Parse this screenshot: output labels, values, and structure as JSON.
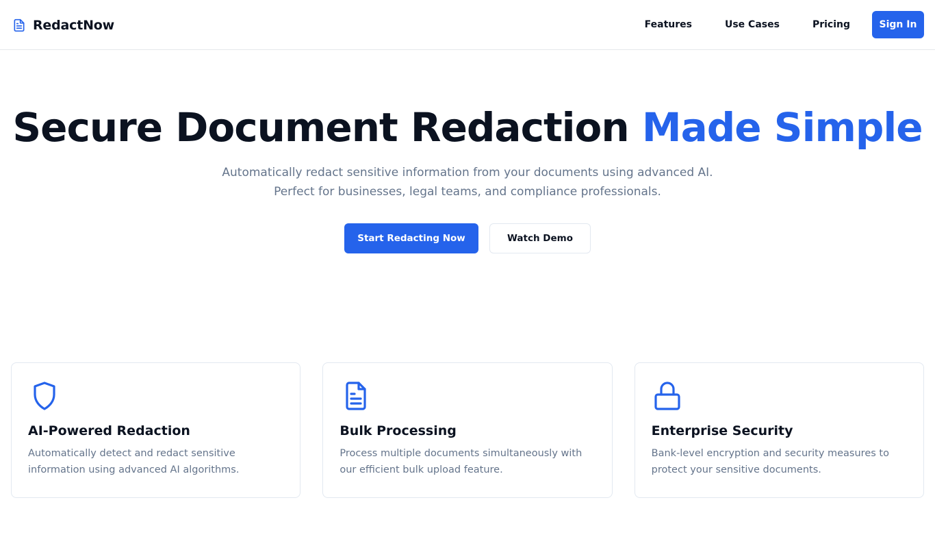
{
  "brand": {
    "name": "RedactNow",
    "icon": "file-text-icon",
    "color": "#2563eb"
  },
  "nav": {
    "links": [
      "Features",
      "Use Cases",
      "Pricing"
    ],
    "signin_label": "Sign In"
  },
  "hero": {
    "title_main": "Secure Document Redaction",
    "title_accent": "Made Simple",
    "subtitle_line1": "Automatically redact sensitive information from your documents using advanced AI.",
    "subtitle_line2": "Perfect for businesses, legal teams, and compliance professionals.",
    "primary_cta": "Start Redacting Now",
    "secondary_cta": "Watch Demo"
  },
  "features": [
    {
      "icon": "shield-icon",
      "title": "AI-Powered Redaction",
      "description": "Automatically detect and redact sensitive information using advanced AI algorithms."
    },
    {
      "icon": "file-text-icon",
      "title": "Bulk Processing",
      "description": "Process multiple documents simultaneously with our efficient bulk upload feature."
    },
    {
      "icon": "lock-icon",
      "title": "Enterprise Security",
      "description": "Bank-level encryption and security measures to protect your sensitive documents."
    }
  ],
  "colors": {
    "accent": "#2563eb",
    "text": "#0b1220",
    "muted": "#64748b",
    "border": "#e2e8f0"
  }
}
